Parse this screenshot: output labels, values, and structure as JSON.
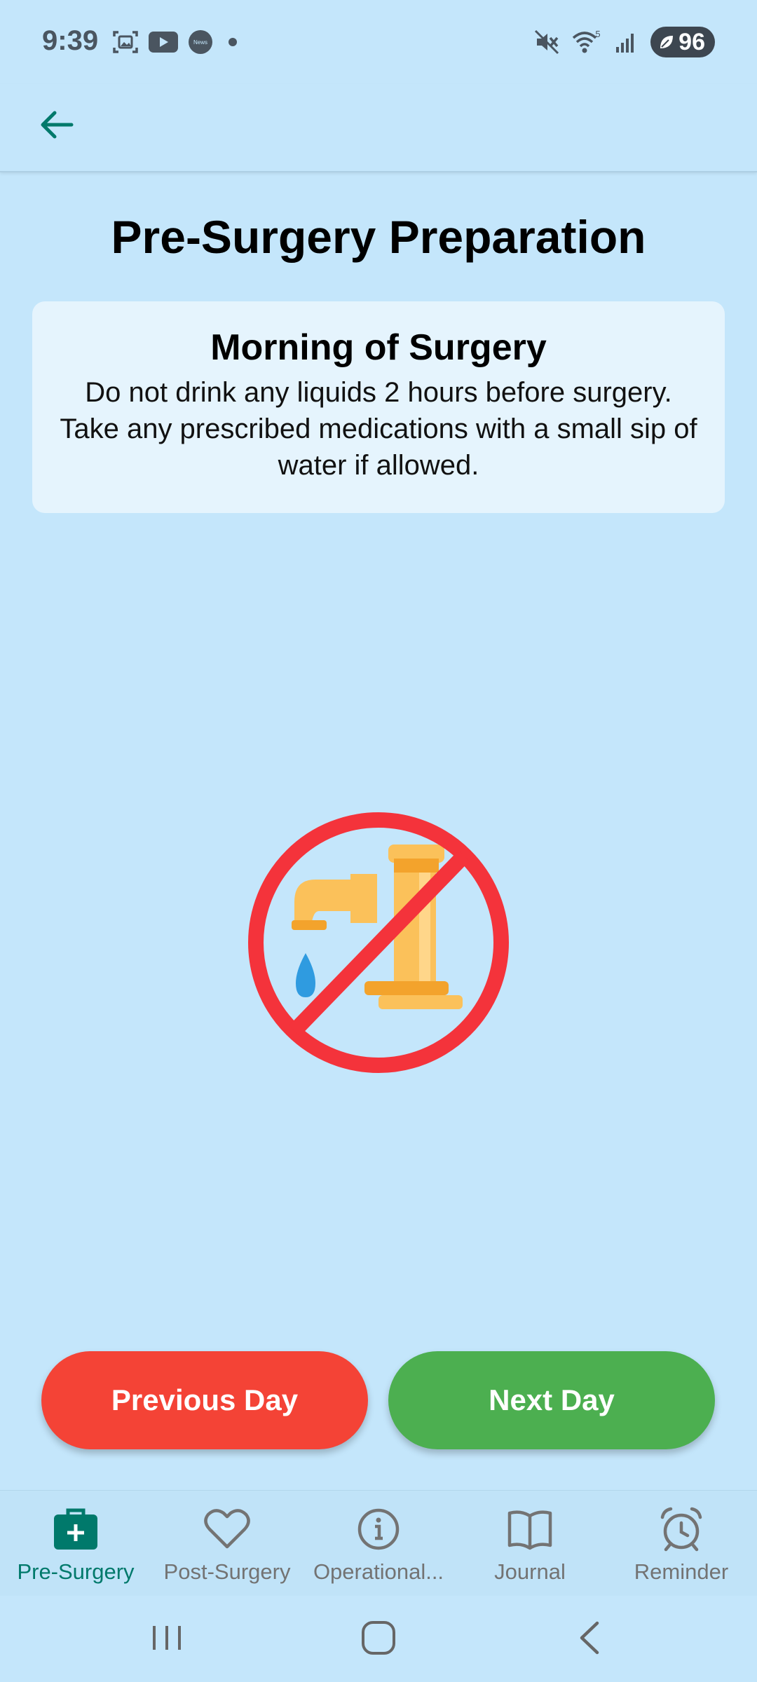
{
  "status_bar": {
    "time": "9:39",
    "battery": "96",
    "left_icons": [
      "screenshot-icon",
      "youtube-icon",
      "news-icon",
      "dot-icon"
    ],
    "right_icons": [
      "mute-icon",
      "wifi-icon",
      "signal-icon",
      "battery-icon"
    ],
    "news_label": "News",
    "wifi_label": "5"
  },
  "app_bar": {
    "back_icon": "arrow-left-icon"
  },
  "page": {
    "title": "Pre-Surgery Preparation"
  },
  "card": {
    "title": "Morning of Surgery",
    "body": "Do not drink any liquids 2 hours before surgery. Take any prescribed medications with a small sip of water if allowed."
  },
  "illustration": {
    "icon": "no-water-faucet-icon"
  },
  "buttons": {
    "previous": "Previous Day",
    "next": "Next Day"
  },
  "bottom_nav": {
    "items": [
      {
        "label": "Pre-Surgery",
        "icon": "medical-kit-icon",
        "active": true
      },
      {
        "label": "Post-Surgery",
        "icon": "heart-icon",
        "active": false
      },
      {
        "label": "Operational...",
        "icon": "info-icon",
        "active": false
      },
      {
        "label": "Journal",
        "icon": "book-icon",
        "active": false
      },
      {
        "label": "Reminder",
        "icon": "alarm-clock-icon",
        "active": false
      }
    ]
  },
  "colors": {
    "background": "#c4e6fb",
    "card": "#e5f4fd",
    "accent": "#00796b",
    "previous_button": "#f44336",
    "next_button": "#4caf50"
  }
}
